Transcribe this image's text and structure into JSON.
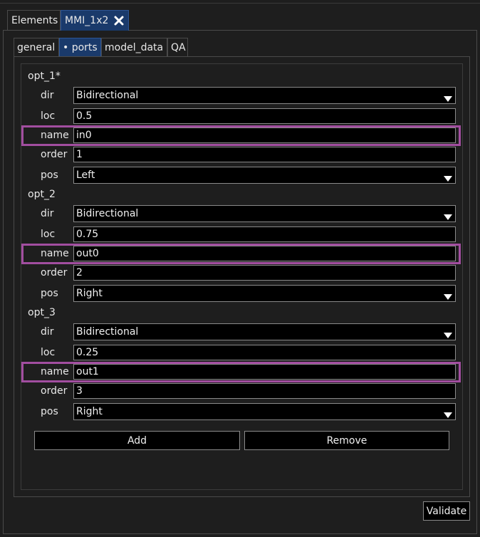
{
  "editor_tabs": [
    {
      "label": "Elements"
    },
    {
      "label": "MMI_1x2",
      "close_icon": "close-x-icon"
    }
  ],
  "sub_tabs": [
    {
      "label": "general"
    },
    {
      "label": "• ports"
    },
    {
      "label": "model_data"
    },
    {
      "label": "QA"
    }
  ],
  "labels": {
    "dir": "dir",
    "loc": "loc",
    "name": "name",
    "order": "order",
    "pos": "pos"
  },
  "ports": [
    {
      "header": "opt_1*",
      "dir": "Bidirectional",
      "loc": "0.5",
      "name": "in0",
      "order": "1",
      "pos": "Left"
    },
    {
      "header": "opt_2",
      "dir": "Bidirectional",
      "loc": "0.75",
      "name": "out0",
      "order": "2",
      "pos": "Right"
    },
    {
      "header": "opt_3",
      "dir": "Bidirectional",
      "loc": "0.25",
      "name": "out1",
      "order": "3",
      "pos": "Right"
    }
  ],
  "buttons": {
    "add": "Add",
    "remove": "Remove",
    "validate": "Validate"
  },
  "colors": {
    "highlight": "#a24ea0",
    "active_tab": "#1a3a6b",
    "background": "#1e1e1e"
  }
}
